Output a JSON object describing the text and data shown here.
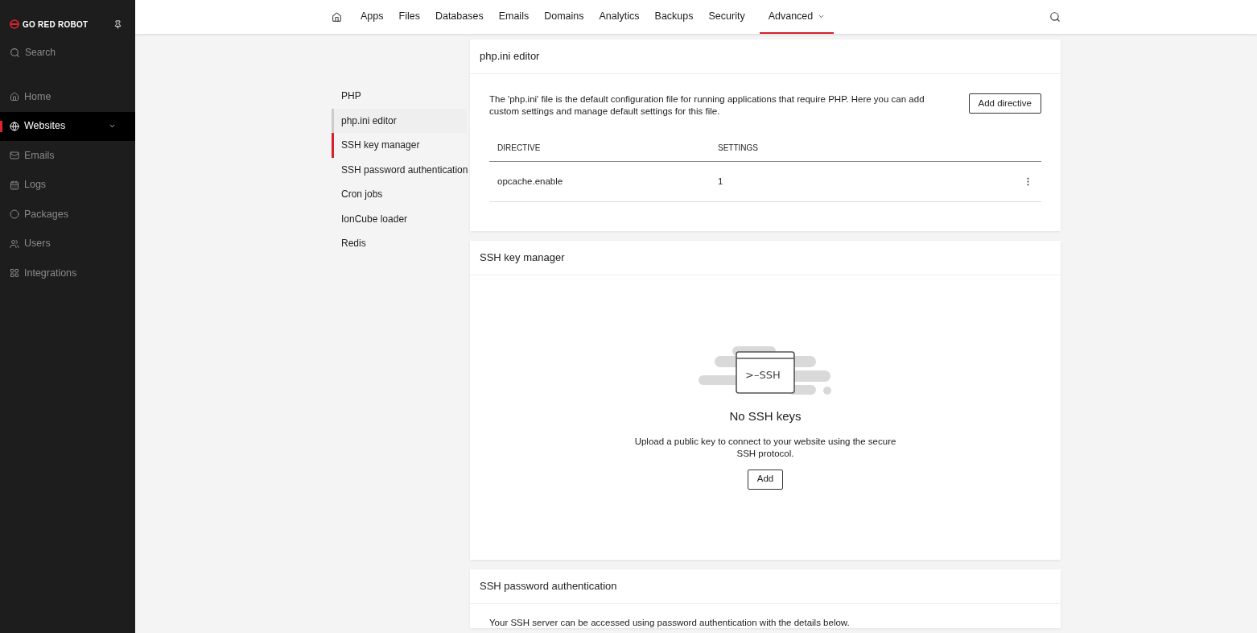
{
  "sidebar": {
    "brand": "GO RED ROBOT",
    "search": {
      "placeholder": "Search"
    },
    "items": [
      {
        "label": "Home",
        "selected": false,
        "expandable": false
      },
      {
        "label": "Websites",
        "selected": true,
        "expandable": true
      },
      {
        "label": "Emails",
        "selected": false,
        "expandable": false
      },
      {
        "label": "Logs",
        "selected": false,
        "expandable": false
      },
      {
        "label": "Packages",
        "selected": false,
        "expandable": false
      },
      {
        "label": "Users",
        "selected": false,
        "expandable": false
      },
      {
        "label": "Integrations",
        "selected": false,
        "expandable": false
      }
    ]
  },
  "top_nav": {
    "tabs": [
      {
        "label": "Apps",
        "selected": false,
        "dropdown": false
      },
      {
        "label": "Files",
        "selected": false,
        "dropdown": false
      },
      {
        "label": "Databases",
        "selected": false,
        "dropdown": false
      },
      {
        "label": "Emails",
        "selected": false,
        "dropdown": false
      },
      {
        "label": "Domains",
        "selected": false,
        "dropdown": false
      },
      {
        "label": "Analytics",
        "selected": false,
        "dropdown": false
      },
      {
        "label": "Backups",
        "selected": false,
        "dropdown": false
      },
      {
        "label": "Security",
        "selected": false,
        "dropdown": false
      },
      {
        "label": "Advanced",
        "selected": true,
        "dropdown": true
      }
    ]
  },
  "sub_nav": [
    {
      "label": "PHP",
      "selected": false,
      "hovered": false
    },
    {
      "label": "php.ini editor",
      "selected": false,
      "hovered": true
    },
    {
      "label": "SSH key manager",
      "selected": true,
      "hovered": false
    },
    {
      "label": "SSH password authentication",
      "selected": false,
      "hovered": false
    },
    {
      "label": "Cron jobs",
      "selected": false,
      "hovered": false
    },
    {
      "label": "IonCube loader",
      "selected": false,
      "hovered": false
    },
    {
      "label": "Redis",
      "selected": false,
      "hovered": false
    }
  ],
  "php_ini_card": {
    "title": "php.ini editor",
    "description": "The 'php.ini' file is the default configuration file for running applications that require PHP. Here you can add custom settings and manage default settings for this file.",
    "button": "Add directive",
    "table": {
      "columns": [
        "DIRECTIVE",
        "SETTINGS"
      ],
      "rows": [
        [
          "opcache.enable",
          "1"
        ]
      ]
    }
  },
  "ssh_key_card": {
    "title": "SSH key manager",
    "illustration_label": ">–SSH",
    "empty_title": "No SSH keys",
    "empty_text": "Upload a public key to connect to your website using the secure SSH protocol.",
    "button": "Add"
  },
  "ssh_password_card": {
    "title": "SSH password authentication",
    "text": "Your SSH server can be accessed using password authentication with the details below."
  }
}
